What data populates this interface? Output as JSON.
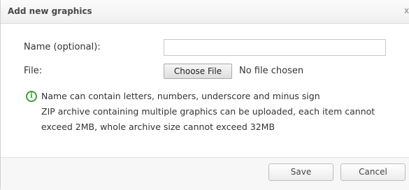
{
  "dialog": {
    "title": "Add new graphics",
    "close_label": "x"
  },
  "form": {
    "name_label": "Name (optional):",
    "name_value": "",
    "file_label": "File:",
    "choose_file_label": "Choose File",
    "no_file_text": "No file chosen"
  },
  "info": {
    "icon": "info-icon",
    "line1": "Name can contain letters, numbers, underscore and minus sign",
    "line2": "ZIP archive containing multiple graphics can be uploaded, each item cannot exceed 2MB, whole archive size cannot exceed 32MB"
  },
  "footer": {
    "save_label": "Save",
    "cancel_label": "Cancel"
  },
  "colors": {
    "info_icon": "#3aa23a"
  }
}
